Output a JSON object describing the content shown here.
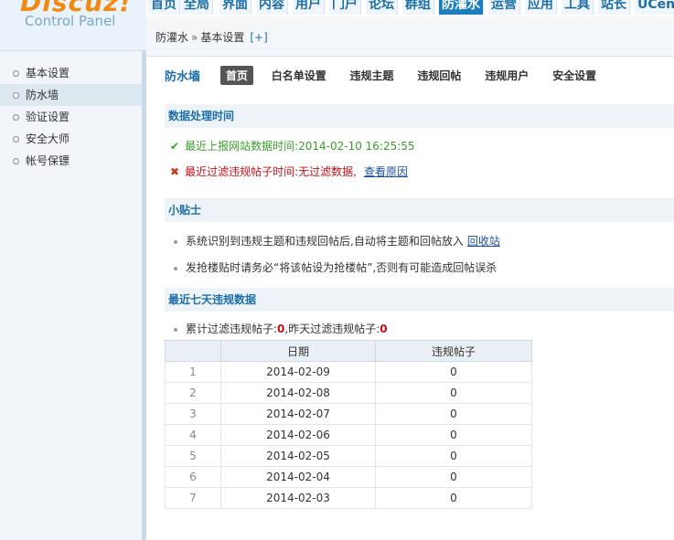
{
  "logo": {
    "brand": "Discuz!",
    "subtitle": "Control Panel"
  },
  "top_nav": [
    {
      "label": "首页",
      "active": false
    },
    {
      "label": "全局",
      "active": false
    },
    {
      "label": "界面",
      "active": false
    },
    {
      "label": "内容",
      "active": false
    },
    {
      "label": "用户",
      "active": false
    },
    {
      "label": "门户",
      "active": false
    },
    {
      "label": "论坛",
      "active": false
    },
    {
      "label": "群组",
      "active": false
    },
    {
      "label": "防灌水",
      "active": true
    },
    {
      "label": "运营",
      "active": false
    },
    {
      "label": "应用",
      "active": false
    },
    {
      "label": "工具",
      "active": false
    },
    {
      "label": "站长",
      "active": false
    },
    {
      "label": "UCent",
      "active": false
    }
  ],
  "breadcrumb": {
    "root": "防灌水",
    "sep": "»",
    "current": "基本设置",
    "add": "[+]"
  },
  "sidebar": {
    "items": [
      {
        "label": "基本设置",
        "active": false
      },
      {
        "label": "防水墙",
        "active": true
      },
      {
        "label": "验证设置",
        "active": false
      },
      {
        "label": "安全大师",
        "active": false
      },
      {
        "label": "帐号保镖",
        "active": false
      }
    ]
  },
  "subnav": {
    "title": "防水墙",
    "items": [
      {
        "label": "首页",
        "active": true
      },
      {
        "label": "白名单设置",
        "active": false
      },
      {
        "label": "违规主题",
        "active": false
      },
      {
        "label": "违规回帖",
        "active": false
      },
      {
        "label": "违规用户",
        "active": false
      },
      {
        "label": "安全设置",
        "active": false
      }
    ]
  },
  "processing": {
    "heading": "数据处理时间",
    "report_label": "最近上报网站数据时间:",
    "report_time": "2014-02-10 16:25:55",
    "filter_label": "最近过滤违规帖子时间:",
    "filter_value": "无过滤数据,",
    "filter_link": "查看原因"
  },
  "tips": {
    "heading": "小贴士",
    "tip1": "系统识别到违规主题和违规回帖后,自动将主题和回帖放入",
    "tip1_link": "回收站",
    "tip2": "发抢楼贴时请务必“将该帖设为抢楼帖”,否则有可能造成回帖误杀"
  },
  "weekly": {
    "heading": "最近七天违规数据",
    "total_label": "累计过滤违规帖子:",
    "total_value": "0",
    "yesterday_label": ",昨天过滤违规帖子:",
    "yesterday_value": "0",
    "columns": [
      "",
      "日期",
      "违规帖子"
    ],
    "rows": [
      {
        "idx": "1",
        "date": "2014-02-09",
        "count": "0"
      },
      {
        "idx": "2",
        "date": "2014-02-08",
        "count": "0"
      },
      {
        "idx": "3",
        "date": "2014-02-07",
        "count": "0"
      },
      {
        "idx": "4",
        "date": "2014-02-06",
        "count": "0"
      },
      {
        "idx": "5",
        "date": "2014-02-05",
        "count": "0"
      },
      {
        "idx": "6",
        "date": "2014-02-04",
        "count": "0"
      },
      {
        "idx": "7",
        "date": "2014-02-03",
        "count": "0"
      }
    ]
  },
  "colors": {
    "accent": "#1d6fa8",
    "active_tab": "#1b7fbf",
    "ok": "#3a9c2c",
    "error": "#c3111b",
    "brand": "#f28a12"
  }
}
